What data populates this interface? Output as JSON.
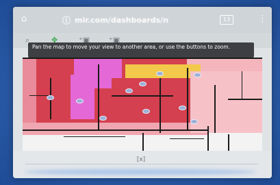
{
  "browser": {
    "url": "mir.com/dashboards/n",
    "tab_count": "13"
  },
  "toolbar": {
    "tools": [
      "search-tool",
      "pin-tool",
      "camera-tool-1",
      "camera-tool-2"
    ]
  },
  "tooltip": {
    "text": "Pan the map to move your view to another area, or use the buttons to zoom."
  },
  "footer": {
    "center_button": "[x]"
  },
  "colors": {
    "red_zone": "#d4404f",
    "pink_zone": "#e98b9a",
    "light_pink_zone": "#f5b5bd",
    "magenta_zone": "#e468d6",
    "yellow_zone": "#f2c94a"
  }
}
